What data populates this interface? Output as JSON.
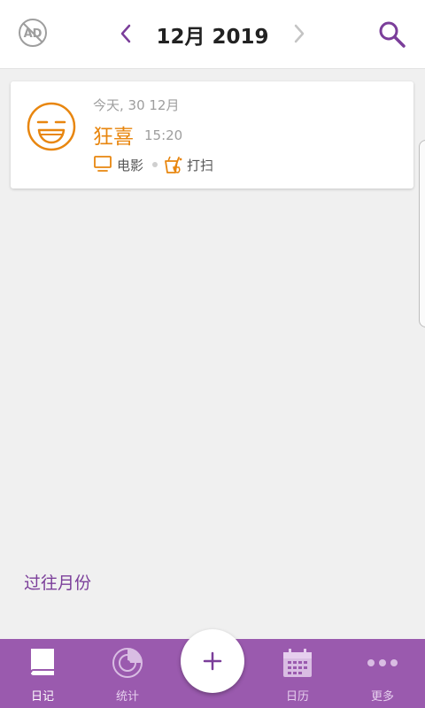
{
  "header": {
    "month_title": "12月 2019",
    "icons": [
      "no-ads-icon",
      "chevron-left-icon",
      "chevron-right-icon",
      "search-icon"
    ]
  },
  "entries": [
    {
      "date": "今天, 30 12月",
      "mood": "狂喜",
      "time": "15:20",
      "mood_icon": "laughing-face-icon",
      "activities": [
        {
          "label": "电影",
          "icon": "tv-icon"
        },
        {
          "label": "打扫",
          "icon": "cleaning-bucket-icon"
        }
      ]
    }
  ],
  "past_months_link": "过往月份",
  "bottom_nav": {
    "tabs": [
      {
        "label": "日记",
        "icon": "book-icon"
      },
      {
        "label": "统计",
        "icon": "stats-disc-icon"
      },
      {
        "label": "日历",
        "icon": "calendar-icon"
      },
      {
        "label": "更多",
        "icon": "more-dots-icon"
      }
    ],
    "active_tab": "日记",
    "add_icon": "plus-icon"
  },
  "colors": {
    "accent_purple": "#9a5aae",
    "mood_orange": "#e8860f",
    "link_purple": "#7b3e9a"
  }
}
